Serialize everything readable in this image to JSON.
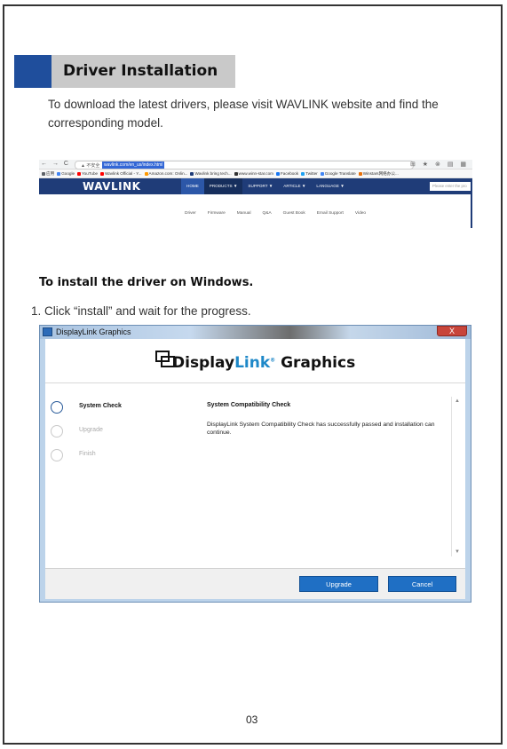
{
  "section": {
    "title": "Driver Installation",
    "intro": "To download the latest drivers, please visit WAVLINK website and find the corresponding model."
  },
  "browser": {
    "nav_buttons": "← → C",
    "security": "▲ 不安全",
    "url": "wavlink.com/en_us/index.html",
    "toolbar_icons": "⊞ ★ ⊗ ▤ ▦",
    "bookmarks": [
      {
        "label": "应用",
        "color": "#5f6368"
      },
      {
        "label": "Google",
        "color": "#4285f4"
      },
      {
        "label": "YouTube",
        "color": "#ff0000"
      },
      {
        "label": "Wavlink Official - Y...",
        "color": "#ff0000"
      },
      {
        "label": "Amazon.com: Onlin...",
        "color": "#ff9900"
      },
      {
        "label": "Wavlink bring tech...",
        "color": "#1f3c78"
      },
      {
        "label": "www.winn-star.com",
        "color": "#333333"
      },
      {
        "label": "Facebook",
        "color": "#1877f2"
      },
      {
        "label": "Twitter",
        "color": "#1da1f2"
      },
      {
        "label": "Google Translate",
        "color": "#4285f4"
      },
      {
        "label": "Winstars网络办公...",
        "color": "#e8710a"
      }
    ],
    "logo": "WAVLINK",
    "menu": [
      "HOME",
      "PRODUCTS ▼",
      "SUPPORT ▼",
      "ARTICLE ▼",
      "LANGUAGE ▼"
    ],
    "search_placeholder": "Please enter the pro",
    "submenu": [
      "Driver",
      "Firmware",
      "Manual",
      "Q&A",
      "Guest Book",
      "Email Support",
      "Video"
    ]
  },
  "windows_section": {
    "heading": "To install the driver on Windows.",
    "step1": "1. Click “install” and wait for the progress."
  },
  "installer": {
    "window_title": "DisplayLink Graphics",
    "close_label": "X",
    "brand_display": "Display",
    "brand_link": "Link",
    "brand_reg": "®",
    "brand_graphics": "Graphics",
    "steps": [
      {
        "label": "System Check",
        "active": true
      },
      {
        "label": "Upgrade",
        "active": false
      },
      {
        "label": "Finish",
        "active": false
      }
    ],
    "check_heading": "System Compatibility Check",
    "check_text": "DisplayLink System Compatibility Check has successfully passed and installation can continue.",
    "scroll_up": "▲",
    "scroll_down": "▼",
    "upgrade_button": "Upgrade",
    "cancel_button": "Cancel"
  },
  "page_number": "03"
}
